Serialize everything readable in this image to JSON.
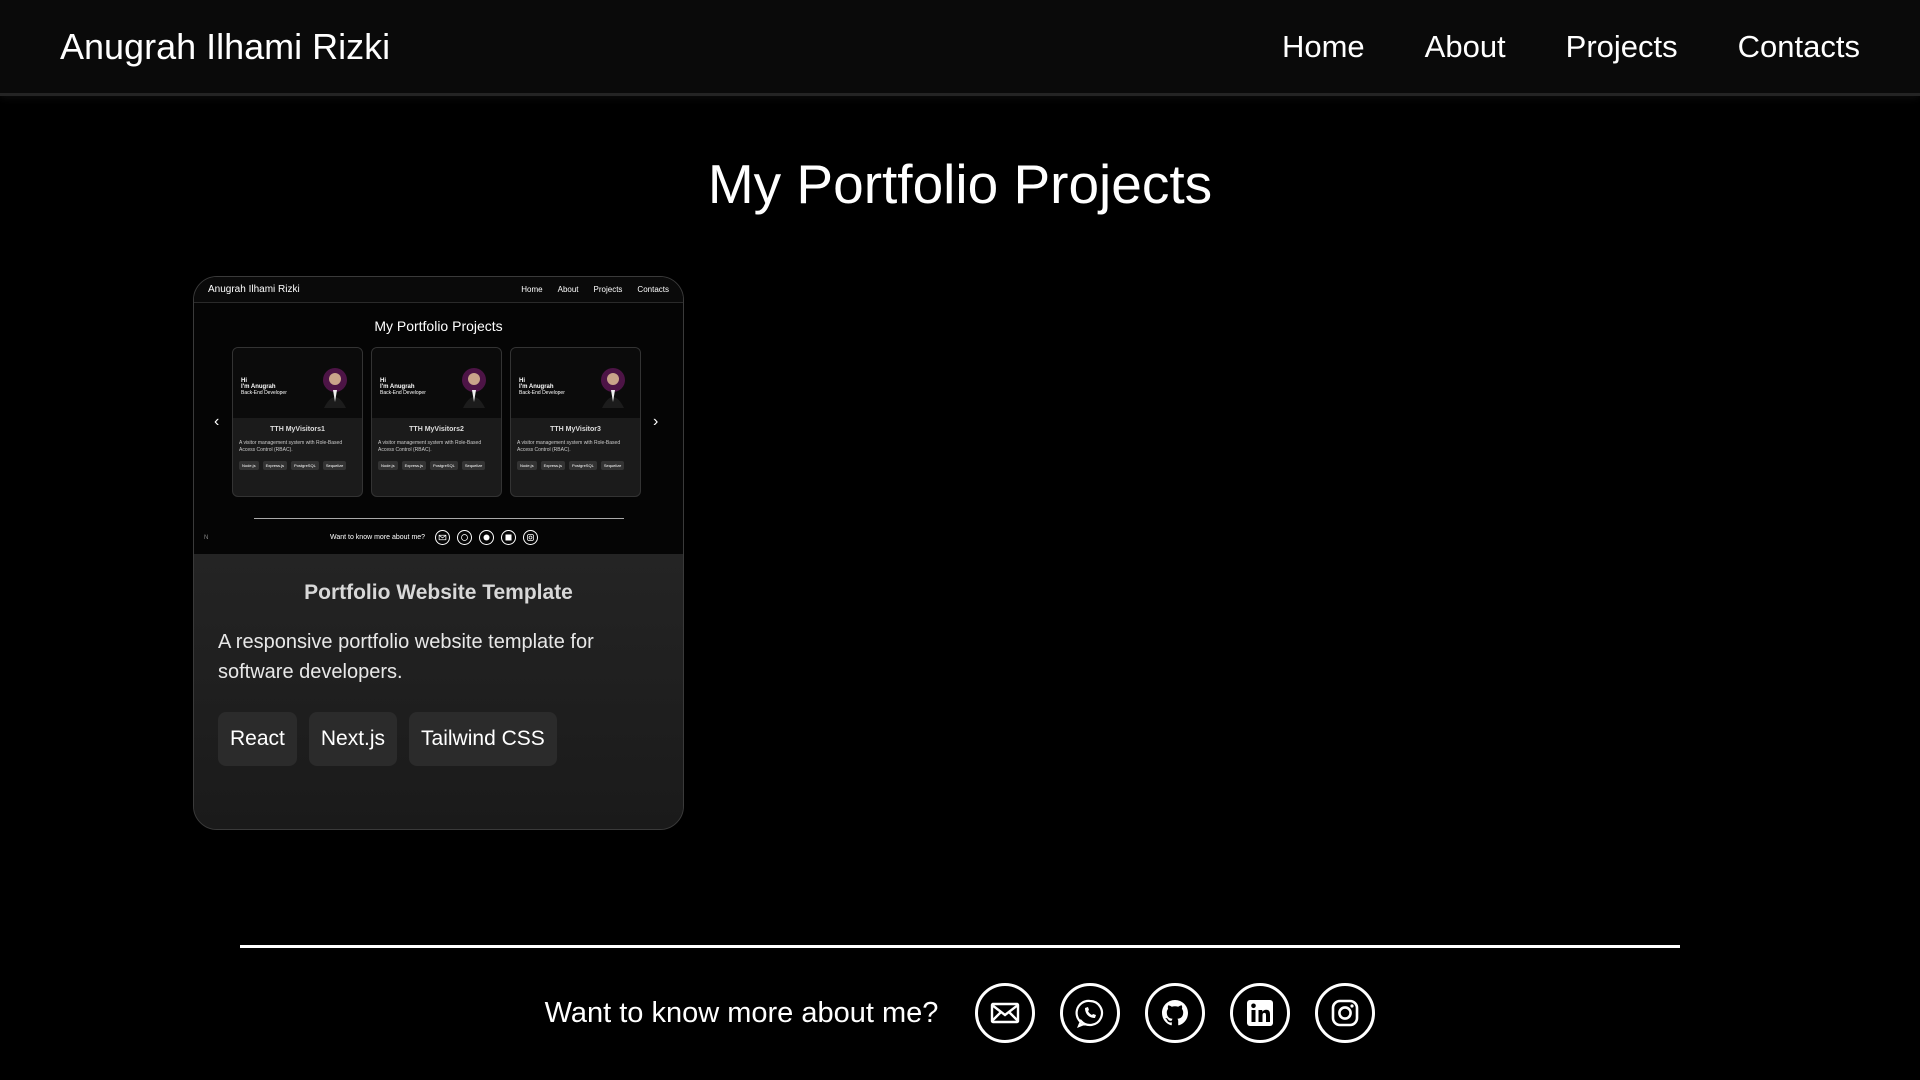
{
  "nav": {
    "brand": "Anugrah Ilhami Rizki",
    "links": [
      "Home",
      "About",
      "Projects",
      "Contacts"
    ]
  },
  "page_title": "My Portfolio Projects",
  "project": {
    "title": "Portfolio Website Template",
    "description": "A responsive portfolio website template for software developers.",
    "tags": [
      "React",
      "Next.js",
      "Tailwind CSS"
    ],
    "thumbnail": {
      "brand": "Anugrah Ilhami Rizki",
      "links": [
        "Home",
        "About",
        "Projects",
        "Contacts"
      ],
      "title": "My Portfolio Projects",
      "cards": [
        {
          "hi": "Hi",
          "name": "I'm Anugrah",
          "role": "Back-End Developer",
          "title": "TTH MyVisitors1",
          "desc": "A visitor management system with Role-Based Access Control (RBAC).",
          "tags": [
            "Node.js",
            "Express.js",
            "PostgreSQL",
            "Sequelize"
          ]
        },
        {
          "hi": "Hi",
          "name": "I'm Anugrah",
          "role": "Back-End Developer",
          "title": "TTH MyVisitors2",
          "desc": "A visitor management system with Role-Based Access Control (RBAC).",
          "tags": [
            "Node.js",
            "Express.js",
            "PostgreSQL",
            "Sequelize"
          ]
        },
        {
          "hi": "Hi",
          "name": "I'm Anugrah",
          "role": "Back-End Developer",
          "title": "TTH MyVisitor3",
          "desc": "A visitor management system with Role-Based Access Control (RBAC).",
          "tags": [
            "Node.js",
            "Express.js",
            "PostgreSQL",
            "Sequelize"
          ]
        }
      ],
      "footer_text": "Want to know more about me?",
      "corner": "N"
    }
  },
  "footer": {
    "text": "Want to know more about me?",
    "icons": [
      "mail-icon",
      "whatsapp-icon",
      "github-icon",
      "linkedin-icon",
      "instagram-icon"
    ]
  },
  "colors": {
    "background": "#000000",
    "navbar": "#0a0a0a",
    "card": "#1a1a1a",
    "tag": "#2b2b2b",
    "text": "#ffffff"
  }
}
